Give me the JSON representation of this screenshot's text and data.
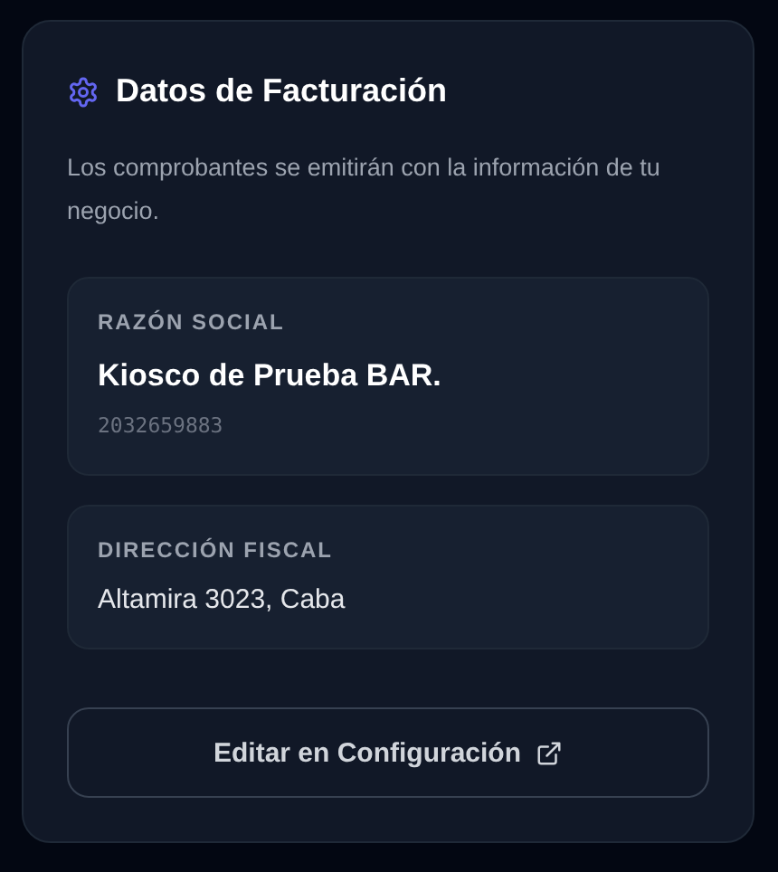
{
  "card": {
    "title": "Datos de Facturación",
    "description": "Los comprobantes se emitirán con la información de tu negocio.",
    "fields": [
      {
        "kind": "entity",
        "label": "RAZÓN SOCIAL",
        "value": "Kiosco de Prueba BAR.",
        "detail": "2032659883"
      },
      {
        "kind": "plain",
        "label": "DIRECCIÓN FISCAL",
        "value": "Altamira 3023, Caba"
      }
    ],
    "button": "Editar en Configuración"
  }
}
